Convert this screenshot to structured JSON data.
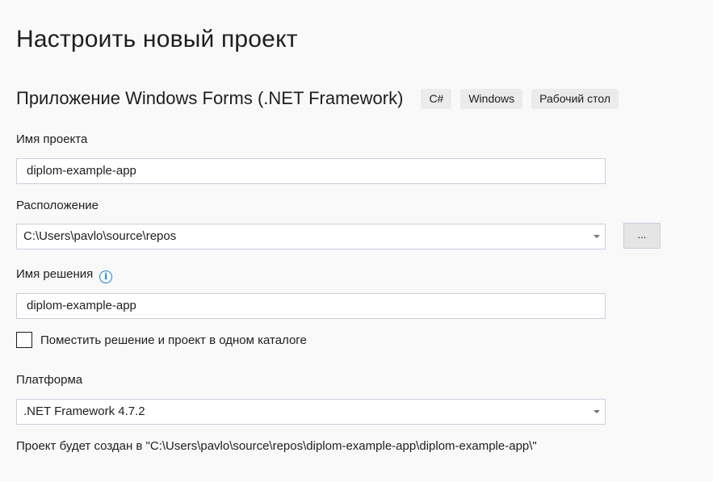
{
  "page": {
    "title": "Настроить новый проект"
  },
  "template": {
    "name": "Приложение Windows Forms (.NET Framework)",
    "tags": [
      "C#",
      "Windows",
      "Рабочий стол"
    ]
  },
  "project_name": {
    "label": "Имя проекта",
    "value": "diplom-example-app"
  },
  "location": {
    "label": "Расположение",
    "value": "C:\\Users\\pavlo\\source\\repos",
    "browse_label": "..."
  },
  "solution_name": {
    "label": "Имя решения",
    "info_icon": "info-icon",
    "value": "diplom-example-app"
  },
  "same_directory": {
    "label": "Поместить решение и проект в одном каталоге",
    "checked": false
  },
  "platform": {
    "label": "Платформа",
    "value": ".NET Framework 4.7.2"
  },
  "summary": {
    "text": "Проект будет создан в \"C:\\Users\\pavlo\\source\\repos\\diplom-example-app\\diplom-example-app\\\""
  }
}
